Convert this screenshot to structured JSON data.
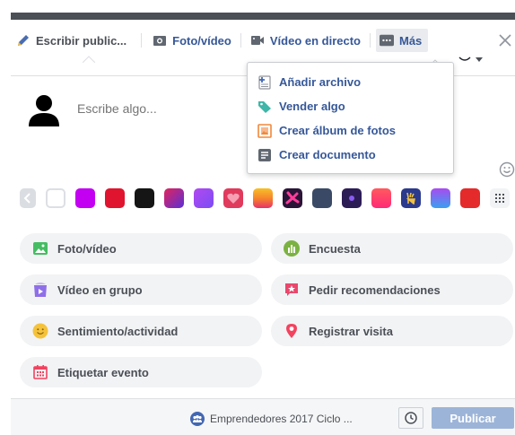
{
  "tabs": [
    {
      "label": "Escribir public...",
      "icon": "pencil-icon"
    },
    {
      "label": "Foto/vídeo",
      "icon": "camera-icon"
    },
    {
      "label": "Vídeo en directo",
      "icon": "video-camera-icon"
    },
    {
      "label": "Más",
      "icon": "more-dots-icon"
    }
  ],
  "composer": {
    "placeholder": "Escribe algo..."
  },
  "more_menu": {
    "items": [
      {
        "label": "Añadir archivo",
        "icon": "add-file-icon"
      },
      {
        "label": "Vender algo",
        "icon": "price-tag-icon"
      },
      {
        "label": "Crear álbum de fotos",
        "icon": "photo-album-icon"
      },
      {
        "label": "Crear documento",
        "icon": "document-icon"
      }
    ]
  },
  "backgrounds": {
    "colors": [
      "#dcdfe4",
      "#c400f3",
      "#e0142e",
      "#151515",
      "#7a2fd6",
      "#b24af0",
      "#e03a5c",
      "#f7852a",
      "#2a1437",
      "#3a4a66",
      "#2c1c56",
      "#ff2876",
      "#2b3a8c",
      "#a84cf0",
      "#e42a2a"
    ]
  },
  "options": [
    {
      "label": "Foto/vídeo",
      "icon": "photo-icon"
    },
    {
      "label": "Encuesta",
      "icon": "poll-icon"
    },
    {
      "label": "Vídeo en grupo",
      "icon": "group-video-icon"
    },
    {
      "label": "Pedir recomendaciones",
      "icon": "recommendation-icon"
    },
    {
      "label": "Sentimiento/actividad",
      "icon": "smiley-icon"
    },
    {
      "label": "Registrar visita",
      "icon": "location-pin-icon"
    },
    {
      "label": "Etiquetar evento",
      "icon": "calendar-icon"
    }
  ],
  "footer": {
    "audience": "Emprendedores 2017 Ciclo ...",
    "publish_label": "Publicar"
  },
  "colors": {
    "link_blue": "#365899",
    "publish_disabled": "#9cb4d8"
  }
}
